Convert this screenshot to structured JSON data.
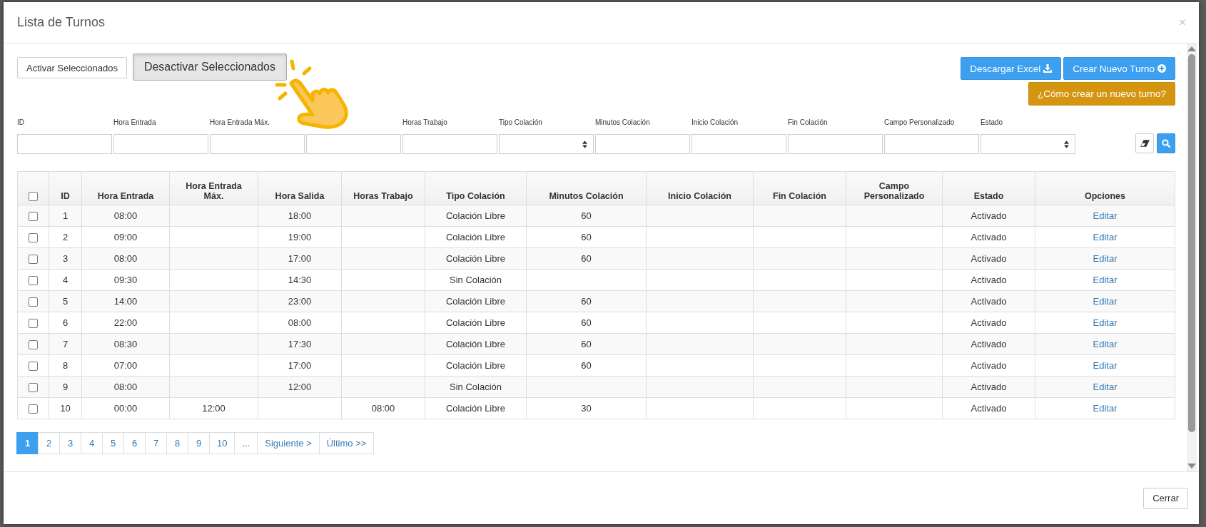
{
  "modal": {
    "title": "Lista de Turnos",
    "close": "×"
  },
  "actions": {
    "left": [
      {
        "label": "Activar Seleccionados",
        "kind": "normal"
      },
      {
        "label": "Desactivar Seleccionados",
        "kind": "pressed"
      }
    ],
    "right": [
      {
        "label": "Descargar Excel",
        "kind": "download"
      },
      {
        "label": "Crear Nuevo Turno",
        "kind": "create"
      }
    ],
    "help": "¿Cómo crear un nuevo turno?"
  },
  "filters": [
    {
      "label": "ID",
      "kind": "text"
    },
    {
      "label": "Hora Entrada",
      "kind": "text"
    },
    {
      "label": "Hora Entrada Máx.",
      "kind": "text"
    },
    {
      "kind": "text"
    },
    {
      "label": "Horas Trabajo",
      "kind": "text"
    },
    {
      "label": "Tipo Colación",
      "kind": "select"
    },
    {
      "label": "Minutos Colación",
      "kind": "text"
    },
    {
      "label": "Inicio Colación",
      "kind": "text"
    },
    {
      "label": "Fin Colación",
      "kind": "text"
    },
    {
      "label": "Campo Personalizado",
      "kind": "text"
    },
    {
      "label": "Estado",
      "kind": "select"
    }
  ],
  "table": {
    "select_all_checked": false,
    "columns": [
      "ID",
      "Hora Entrada",
      "Hora Entrada Máx.",
      "Hora Salida",
      "Horas Trabajo",
      "Tipo Colación",
      "Minutos Colación",
      "Inicio Colación",
      "Fin Colación",
      "Campo Personalizado",
      "Estado",
      "Opciones"
    ],
    "rows": [
      {
        "checked": false,
        "cells": [
          "1",
          "08:00",
          null,
          "18:00",
          null,
          "Colación Libre",
          "60",
          null,
          null,
          null,
          "Activado",
          "Editar"
        ]
      },
      {
        "checked": false,
        "cells": [
          "2",
          "09:00",
          null,
          "19:00",
          null,
          "Colación Libre",
          "60",
          null,
          null,
          null,
          "Activado",
          "Editar"
        ]
      },
      {
        "checked": false,
        "cells": [
          "3",
          "08:00",
          null,
          "17:00",
          null,
          "Colación Libre",
          "60",
          null,
          null,
          null,
          "Activado",
          "Editar"
        ]
      },
      {
        "checked": false,
        "cells": [
          "4",
          "09:30",
          null,
          "14:30",
          null,
          "Sin Colación",
          null,
          null,
          null,
          null,
          "Activado",
          "Editar"
        ]
      },
      {
        "checked": false,
        "cells": [
          "5",
          "14:00",
          null,
          "23:00",
          null,
          "Colación Libre",
          "60",
          null,
          null,
          null,
          "Activado",
          "Editar"
        ]
      },
      {
        "checked": false,
        "cells": [
          "6",
          "22:00",
          null,
          "08:00",
          null,
          "Colación Libre",
          "60",
          null,
          null,
          null,
          "Activado",
          "Editar"
        ]
      },
      {
        "checked": false,
        "cells": [
          "7",
          "08:30",
          null,
          "17:30",
          null,
          "Colación Libre",
          "60",
          null,
          null,
          null,
          "Activado",
          "Editar"
        ]
      },
      {
        "checked": false,
        "cells": [
          "8",
          "07:00",
          null,
          "17:00",
          null,
          "Colación Libre",
          "60",
          null,
          null,
          null,
          "Activado",
          "Editar"
        ]
      },
      {
        "checked": false,
        "cells": [
          "9",
          "08:00",
          null,
          "12:00",
          null,
          "Sin Colación",
          null,
          null,
          null,
          null,
          "Activado",
          "Editar"
        ]
      },
      {
        "checked": false,
        "cells": [
          "10",
          "00:00",
          "12:00",
          null,
          "08:00",
          "Colación Libre",
          "30",
          null,
          null,
          null,
          "Activado",
          "Editar"
        ]
      }
    ]
  },
  "pagination": [
    {
      "label": "1",
      "selected": true
    },
    {
      "label": "2",
      "selected": false
    },
    {
      "label": "3",
      "selected": false
    },
    {
      "label": "4",
      "selected": false
    },
    {
      "label": "5",
      "selected": false
    },
    {
      "label": "6",
      "selected": false
    },
    {
      "label": "7",
      "selected": false
    },
    {
      "label": "8",
      "selected": false
    },
    {
      "label": "9",
      "selected": false
    },
    {
      "label": "10",
      "selected": false
    },
    {
      "label": "...",
      "selected": false
    },
    {
      "label": "Siguiente >",
      "selected": false
    },
    {
      "label": "Último >>",
      "selected": false
    }
  ],
  "footer": {
    "close_button": "Cerrar"
  }
}
